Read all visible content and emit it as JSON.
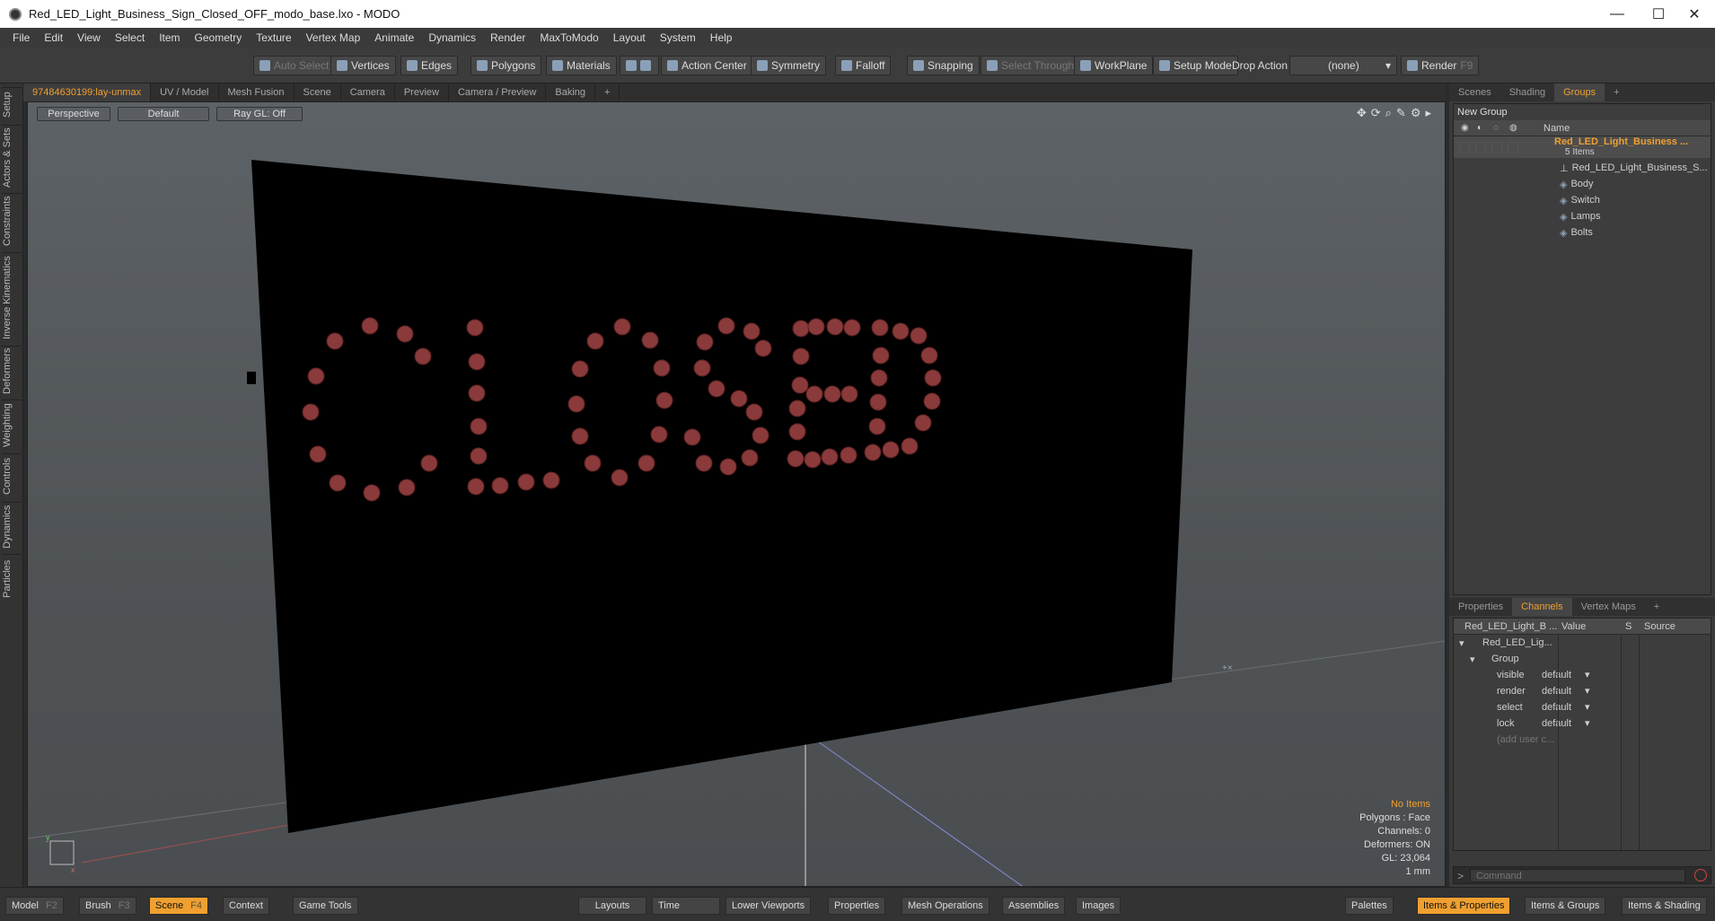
{
  "window": {
    "title": "Red_LED_Light_Business_Sign_Closed_OFF_modo_base.lxo - MODO",
    "minimize": "—",
    "maximize": "☐",
    "close": "✕"
  },
  "menu": [
    "File",
    "Edit",
    "View",
    "Select",
    "Item",
    "Geometry",
    "Texture",
    "Vertex Map",
    "Animate",
    "Dynamics",
    "Render",
    "MaxToModo",
    "Layout",
    "System",
    "Help"
  ],
  "toolbar": {
    "auto_select": "Auto Select",
    "vertices": "Vertices",
    "edges": "Edges",
    "polygons": "Polygons",
    "materials": "Materials",
    "action_center": "Action Center",
    "symmetry": "Symmetry",
    "falloff": "Falloff",
    "snapping": "Snapping",
    "select_through": "Select Through",
    "workplane": "WorkPlane",
    "setup_mode": "Setup Mode",
    "drop_action": "Drop Action",
    "drop_value": "(none)",
    "render": "Render",
    "render_key": "F9"
  },
  "left_tabs": [
    "Setup",
    "Actors & Sets",
    "Constraints",
    "Inverse Kinematics",
    "Deformers",
    "Weighting",
    "Controls",
    "Dynamics",
    "Particles"
  ],
  "viewport_tabs": [
    "97484630199:lay-unmax",
    "UV / Model",
    "Mesh Fusion",
    "Scene",
    "Camera",
    "Preview",
    "Camera / Preview",
    "Baking",
    "+"
  ],
  "viewport": {
    "view": "Perspective",
    "shading": "Default",
    "raygl": "Ray GL: Off",
    "sign_text": "CLOSED",
    "info": [
      "No Items",
      "Polygons : Face",
      "Channels: 0",
      "Deformers: ON",
      "GL: 23,064",
      "1 mm"
    ]
  },
  "groups_panel": {
    "tabs": [
      "Scenes",
      "Shading",
      "Groups",
      "+"
    ],
    "new_group": "New Group",
    "col_name": "Name",
    "root": "Red_LED_Light_Business ...",
    "root_count": "5 Items",
    "children": [
      "Red_LED_Light_Business_S...",
      "Body",
      "Switch",
      "Lamps",
      "Bolts"
    ]
  },
  "channels_panel": {
    "tabs": [
      "Properties",
      "Channels",
      "Vertex Maps",
      "+"
    ],
    "col_item": "Red_LED_Light_B ...",
    "col_value": "Value",
    "col_s": "S",
    "col_source": "Source",
    "item": "Red_LED_Lig...",
    "group": "Group",
    "rows": [
      {
        "name": "visible",
        "value": "default"
      },
      {
        "name": "render",
        "value": "default"
      },
      {
        "name": "select",
        "value": "default"
      },
      {
        "name": "lock",
        "value": "default"
      }
    ],
    "add": "(add user c..."
  },
  "command_placeholder": "Command",
  "bottom": {
    "model": "Model",
    "model_key": "F2",
    "brush": "Brush",
    "brush_key": "F3",
    "scene": "Scene",
    "scene_key": "F4",
    "context": "Context",
    "game_tools": "Game Tools",
    "layouts": "Layouts",
    "time": "Time",
    "lower_viewports": "Lower Viewports",
    "properties": "Properties",
    "mesh_operations": "Mesh Operations",
    "assemblies": "Assemblies",
    "images": "Images",
    "palettes": "Palettes",
    "items_properties": "Items & Properties",
    "items_groups": "Items & Groups",
    "items_shading": "Items & Shading"
  },
  "colors": {
    "accent": "#f0a030",
    "led": "#8a3a3a",
    "sign": "#000000"
  }
}
